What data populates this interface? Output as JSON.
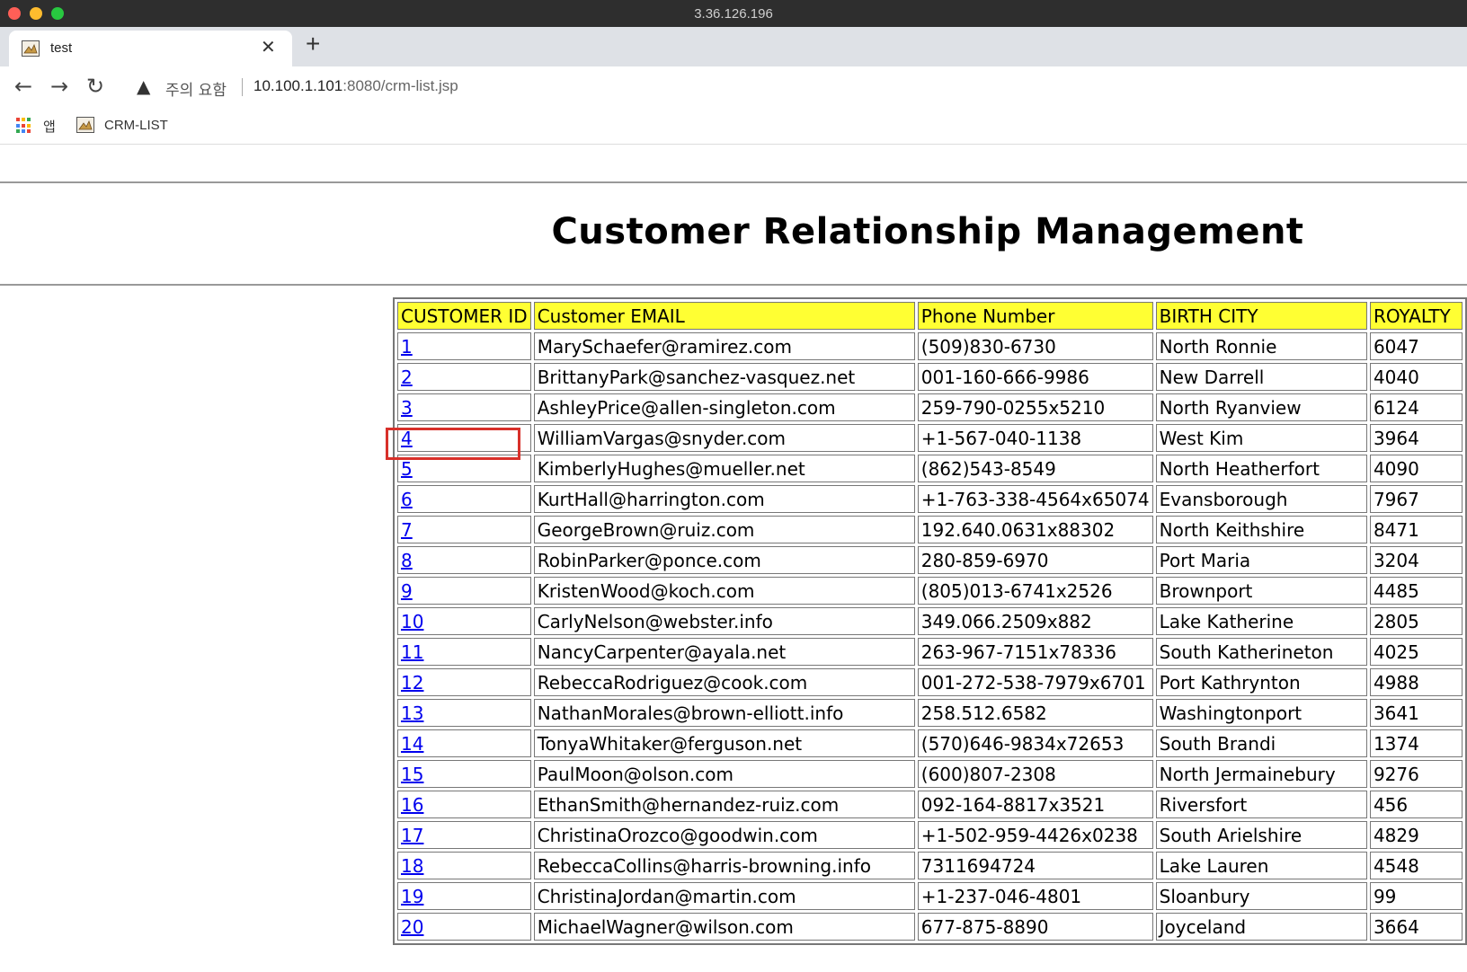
{
  "window": {
    "host": "3.36.126.196",
    "traffic_colors": [
      "#ff5f57",
      "#febc2e",
      "#28c840"
    ]
  },
  "tab": {
    "title": "test"
  },
  "address_bar": {
    "security_label": "주의 요함",
    "url_host": "10.100.1.101",
    "url_rest": ":8080/crm-list.jsp"
  },
  "bookmarks": {
    "apps_label": "앱",
    "items": [
      {
        "label": "CRM-LIST"
      }
    ]
  },
  "page": {
    "heading": "Customer Relationship Management",
    "table": {
      "headers": [
        "CUSTOMER ID",
        "Customer EMAIL",
        "Phone Number",
        "BIRTH CITY",
        "ROYALTY"
      ],
      "header_bg": "#ffff33",
      "highlight_color": "#d8302a",
      "rows": [
        [
          "1",
          "MarySchaefer@ramirez.com",
          "(509)830-6730",
          "North Ronnie",
          "6047"
        ],
        [
          "2",
          "BrittanyPark@sanchez-vasquez.net",
          "001-160-666-9986",
          "New Darrell",
          "4040"
        ],
        [
          "3",
          "AshleyPrice@allen-singleton.com",
          "259-790-0255x5210",
          "North Ryanview",
          "6124"
        ],
        [
          "4",
          "WilliamVargas@snyder.com",
          "+1-567-040-1138",
          "West Kim",
          "3964"
        ],
        [
          "5",
          "KimberlyHughes@mueller.net",
          "(862)543-8549",
          "North Heatherfort",
          "4090"
        ],
        [
          "6",
          "KurtHall@harrington.com",
          "+1-763-338-4564x65074",
          "Evansborough",
          "7967"
        ],
        [
          "7",
          "GeorgeBrown@ruiz.com",
          "192.640.0631x88302",
          "North Keithshire",
          "8471"
        ],
        [
          "8",
          "RobinParker@ponce.com",
          "280-859-6970",
          "Port Maria",
          "3204"
        ],
        [
          "9",
          "KristenWood@koch.com",
          "(805)013-6741x2526",
          "Brownport",
          "4485"
        ],
        [
          "10",
          "CarlyNelson@webster.info",
          "349.066.2509x882",
          "Lake Katherine",
          "2805"
        ],
        [
          "11",
          "NancyCarpenter@ayala.net",
          "263-967-7151x78336",
          "South Katherineton",
          "4025"
        ],
        [
          "12",
          "RebeccaRodriguez@cook.com",
          "001-272-538-7979x6701",
          "Port Kathrynton",
          "4988"
        ],
        [
          "13",
          "NathanMorales@brown-elliott.info",
          "258.512.6582",
          "Washingtonport",
          "3641"
        ],
        [
          "14",
          "TonyaWhitaker@ferguson.net",
          "(570)646-9834x72653",
          "South Brandi",
          "1374"
        ],
        [
          "15",
          "PaulMoon@olson.com",
          "(600)807-2308",
          "North Jermainebury",
          "9276"
        ],
        [
          "16",
          "EthanSmith@hernandez-ruiz.com",
          "092-164-8817x3521",
          "Riversfort",
          "456"
        ],
        [
          "17",
          "ChristinaOrozco@goodwin.com",
          "+1-502-959-4426x0238",
          "South Arielshire",
          "4829"
        ],
        [
          "18",
          "RebeccaCollins@harris-browning.info",
          "7311694724",
          "Lake Lauren",
          "4548"
        ],
        [
          "19",
          "ChristinaJordan@martin.com",
          "+1-237-046-4801",
          "Sloanbury",
          "99"
        ],
        [
          "20",
          "MichaelWagner@wilson.com",
          "677-875-8890",
          "Joyceland",
          "3664"
        ]
      ],
      "highlighted_row": 4
    }
  }
}
